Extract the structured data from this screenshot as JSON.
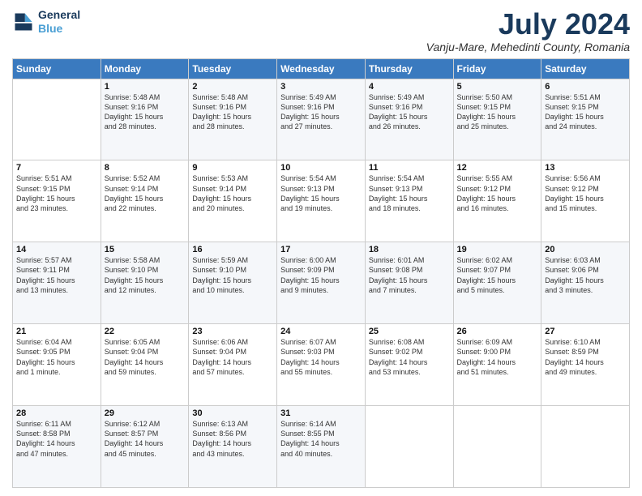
{
  "header": {
    "logo_line1": "General",
    "logo_line2": "Blue",
    "month": "July 2024",
    "location": "Vanju-Mare, Mehedinti County, Romania"
  },
  "days_of_week": [
    "Sunday",
    "Monday",
    "Tuesday",
    "Wednesday",
    "Thursday",
    "Friday",
    "Saturday"
  ],
  "weeks": [
    [
      {
        "day": "",
        "info": ""
      },
      {
        "day": "1",
        "info": "Sunrise: 5:48 AM\nSunset: 9:16 PM\nDaylight: 15 hours\nand 28 minutes."
      },
      {
        "day": "2",
        "info": "Sunrise: 5:48 AM\nSunset: 9:16 PM\nDaylight: 15 hours\nand 28 minutes."
      },
      {
        "day": "3",
        "info": "Sunrise: 5:49 AM\nSunset: 9:16 PM\nDaylight: 15 hours\nand 27 minutes."
      },
      {
        "day": "4",
        "info": "Sunrise: 5:49 AM\nSunset: 9:16 PM\nDaylight: 15 hours\nand 26 minutes."
      },
      {
        "day": "5",
        "info": "Sunrise: 5:50 AM\nSunset: 9:15 PM\nDaylight: 15 hours\nand 25 minutes."
      },
      {
        "day": "6",
        "info": "Sunrise: 5:51 AM\nSunset: 9:15 PM\nDaylight: 15 hours\nand 24 minutes."
      }
    ],
    [
      {
        "day": "7",
        "info": "Sunrise: 5:51 AM\nSunset: 9:15 PM\nDaylight: 15 hours\nand 23 minutes."
      },
      {
        "day": "8",
        "info": "Sunrise: 5:52 AM\nSunset: 9:14 PM\nDaylight: 15 hours\nand 22 minutes."
      },
      {
        "day": "9",
        "info": "Sunrise: 5:53 AM\nSunset: 9:14 PM\nDaylight: 15 hours\nand 20 minutes."
      },
      {
        "day": "10",
        "info": "Sunrise: 5:54 AM\nSunset: 9:13 PM\nDaylight: 15 hours\nand 19 minutes."
      },
      {
        "day": "11",
        "info": "Sunrise: 5:54 AM\nSunset: 9:13 PM\nDaylight: 15 hours\nand 18 minutes."
      },
      {
        "day": "12",
        "info": "Sunrise: 5:55 AM\nSunset: 9:12 PM\nDaylight: 15 hours\nand 16 minutes."
      },
      {
        "day": "13",
        "info": "Sunrise: 5:56 AM\nSunset: 9:12 PM\nDaylight: 15 hours\nand 15 minutes."
      }
    ],
    [
      {
        "day": "14",
        "info": "Sunrise: 5:57 AM\nSunset: 9:11 PM\nDaylight: 15 hours\nand 13 minutes."
      },
      {
        "day": "15",
        "info": "Sunrise: 5:58 AM\nSunset: 9:10 PM\nDaylight: 15 hours\nand 12 minutes."
      },
      {
        "day": "16",
        "info": "Sunrise: 5:59 AM\nSunset: 9:10 PM\nDaylight: 15 hours\nand 10 minutes."
      },
      {
        "day": "17",
        "info": "Sunrise: 6:00 AM\nSunset: 9:09 PM\nDaylight: 15 hours\nand 9 minutes."
      },
      {
        "day": "18",
        "info": "Sunrise: 6:01 AM\nSunset: 9:08 PM\nDaylight: 15 hours\nand 7 minutes."
      },
      {
        "day": "19",
        "info": "Sunrise: 6:02 AM\nSunset: 9:07 PM\nDaylight: 15 hours\nand 5 minutes."
      },
      {
        "day": "20",
        "info": "Sunrise: 6:03 AM\nSunset: 9:06 PM\nDaylight: 15 hours\nand 3 minutes."
      }
    ],
    [
      {
        "day": "21",
        "info": "Sunrise: 6:04 AM\nSunset: 9:05 PM\nDaylight: 15 hours\nand 1 minute."
      },
      {
        "day": "22",
        "info": "Sunrise: 6:05 AM\nSunset: 9:04 PM\nDaylight: 14 hours\nand 59 minutes."
      },
      {
        "day": "23",
        "info": "Sunrise: 6:06 AM\nSunset: 9:04 PM\nDaylight: 14 hours\nand 57 minutes."
      },
      {
        "day": "24",
        "info": "Sunrise: 6:07 AM\nSunset: 9:03 PM\nDaylight: 14 hours\nand 55 minutes."
      },
      {
        "day": "25",
        "info": "Sunrise: 6:08 AM\nSunset: 9:02 PM\nDaylight: 14 hours\nand 53 minutes."
      },
      {
        "day": "26",
        "info": "Sunrise: 6:09 AM\nSunset: 9:00 PM\nDaylight: 14 hours\nand 51 minutes."
      },
      {
        "day": "27",
        "info": "Sunrise: 6:10 AM\nSunset: 8:59 PM\nDaylight: 14 hours\nand 49 minutes."
      }
    ],
    [
      {
        "day": "28",
        "info": "Sunrise: 6:11 AM\nSunset: 8:58 PM\nDaylight: 14 hours\nand 47 minutes."
      },
      {
        "day": "29",
        "info": "Sunrise: 6:12 AM\nSunset: 8:57 PM\nDaylight: 14 hours\nand 45 minutes."
      },
      {
        "day": "30",
        "info": "Sunrise: 6:13 AM\nSunset: 8:56 PM\nDaylight: 14 hours\nand 43 minutes."
      },
      {
        "day": "31",
        "info": "Sunrise: 6:14 AM\nSunset: 8:55 PM\nDaylight: 14 hours\nand 40 minutes."
      },
      {
        "day": "",
        "info": ""
      },
      {
        "day": "",
        "info": ""
      },
      {
        "day": "",
        "info": ""
      }
    ]
  ]
}
